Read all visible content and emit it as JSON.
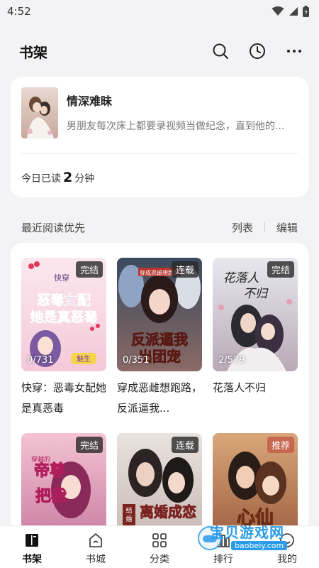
{
  "status": {
    "time": "4:52"
  },
  "header": {
    "title": "书架",
    "icons": [
      "search-icon",
      "history-icon",
      "more-icon"
    ]
  },
  "recent": {
    "title": "情深难昧",
    "desc": "男朋友每次床上都要录视频当做纪念，直到他的...",
    "today_prefix": "今日已读",
    "today_minutes": "2",
    "today_suffix": "分钟"
  },
  "section": {
    "title": "最近阅读优先",
    "list_label": "列表",
    "edit_label": "编辑"
  },
  "books": [
    {
      "title": "快穿：恶毒女配她是真恶毒",
      "badge": "完结",
      "progress": "0/731",
      "cover_text": "恶毒女配她是真恶毒",
      "tag": "快穿",
      "sticker": "魅生"
    },
    {
      "title": "穿成恶雌想跑路，反派逼我...",
      "badge": "连载",
      "progress": "0/351",
      "cover_text": "反派逼我出团宠",
      "tag": "穿成恶雌想跑路"
    },
    {
      "title": "花落人不归",
      "badge": "完结",
      "progress": "2/579",
      "cover_text": "花落人不归"
    },
    {
      "title": "",
      "badge": "完结",
      "progress": "",
      "cover_text": "帝尊后宫把我宠",
      "tag": "穿越的"
    },
    {
      "title": "",
      "badge": "连载",
      "progress": "",
      "cover_text": "离婚后前夫恋爱脑",
      "tag": "结婚五年"
    },
    {
      "title": "",
      "badge": "推荐",
      "progress": "",
      "cover_text": "心仙"
    }
  ],
  "tabs": [
    {
      "label": "书架",
      "icon": "bookshelf-icon"
    },
    {
      "label": "书城",
      "icon": "store-icon"
    },
    {
      "label": "分类",
      "icon": "category-icon"
    },
    {
      "label": "排行",
      "icon": "rank-icon"
    },
    {
      "label": "我的",
      "icon": "profile-icon"
    }
  ],
  "watermark": {
    "text": "宝贝游戏网",
    "url": "baobeiy.com"
  },
  "colors": {
    "background": "#f3f3f5",
    "card": "#ffffff",
    "badge": "#333333",
    "recommend_badge": "#c4604a",
    "watermark": "#2a9be8"
  }
}
